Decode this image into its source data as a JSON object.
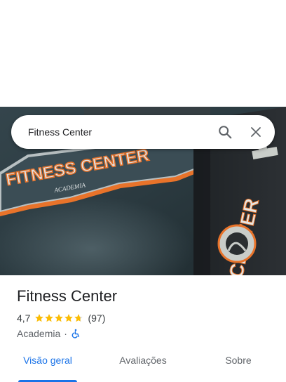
{
  "search": {
    "query": "Fitness Center",
    "search_icon": "search-icon",
    "close_icon": "close-icon"
  },
  "hero": {
    "sign_main_text": "FITNESS CENTER",
    "sign_sub_text": "ACADEMIA",
    "banner_text": "CENTER"
  },
  "place": {
    "title": "Fitness Center",
    "rating": "4,7",
    "rating_stars": 4.7,
    "review_count": "(97)",
    "category": "Academia",
    "separator": "·",
    "accessibility_icon": "wheelchair-icon"
  },
  "tabs": [
    {
      "label": "Visão geral",
      "active": true
    },
    {
      "label": "Avaliações",
      "active": false
    },
    {
      "label": "Sobre",
      "active": false
    }
  ],
  "colors": {
    "accent": "#1a73e8",
    "star": "#fbbc04",
    "star_empty": "#dadce0",
    "sign_orange": "#e8732a"
  }
}
